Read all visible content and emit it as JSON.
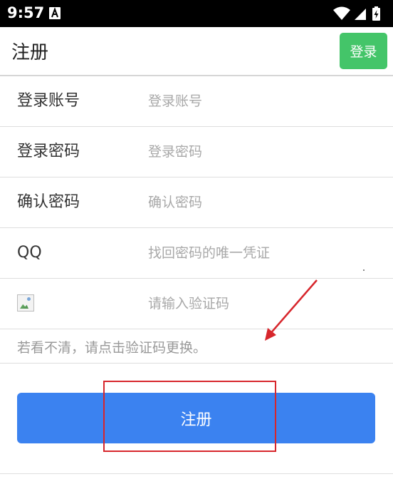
{
  "status_bar": {
    "time": "9:57",
    "notification_icon": "a-notification-icon",
    "icons": [
      "wifi-icon",
      "cell-signal-icon",
      "battery-charging-icon"
    ]
  },
  "header": {
    "title": "注册",
    "login_label": "登录",
    "login_color": "#44c569"
  },
  "form": {
    "fields": [
      {
        "label": "登录账号",
        "placeholder": "登录账号"
      },
      {
        "label": "登录密码",
        "placeholder": "登录密码"
      },
      {
        "label": "确认密码",
        "placeholder": "确认密码"
      },
      {
        "label": "QQ",
        "placeholder": "找回密码的唯一凭证"
      }
    ],
    "captcha": {
      "image_icon": "broken-image-icon",
      "placeholder": "请输入验证码"
    },
    "hint": "若看不清，请点击验证码更换。"
  },
  "register": {
    "label": "注册",
    "color": "#3b82f0"
  },
  "annotation": {
    "color": "#d7262c"
  }
}
